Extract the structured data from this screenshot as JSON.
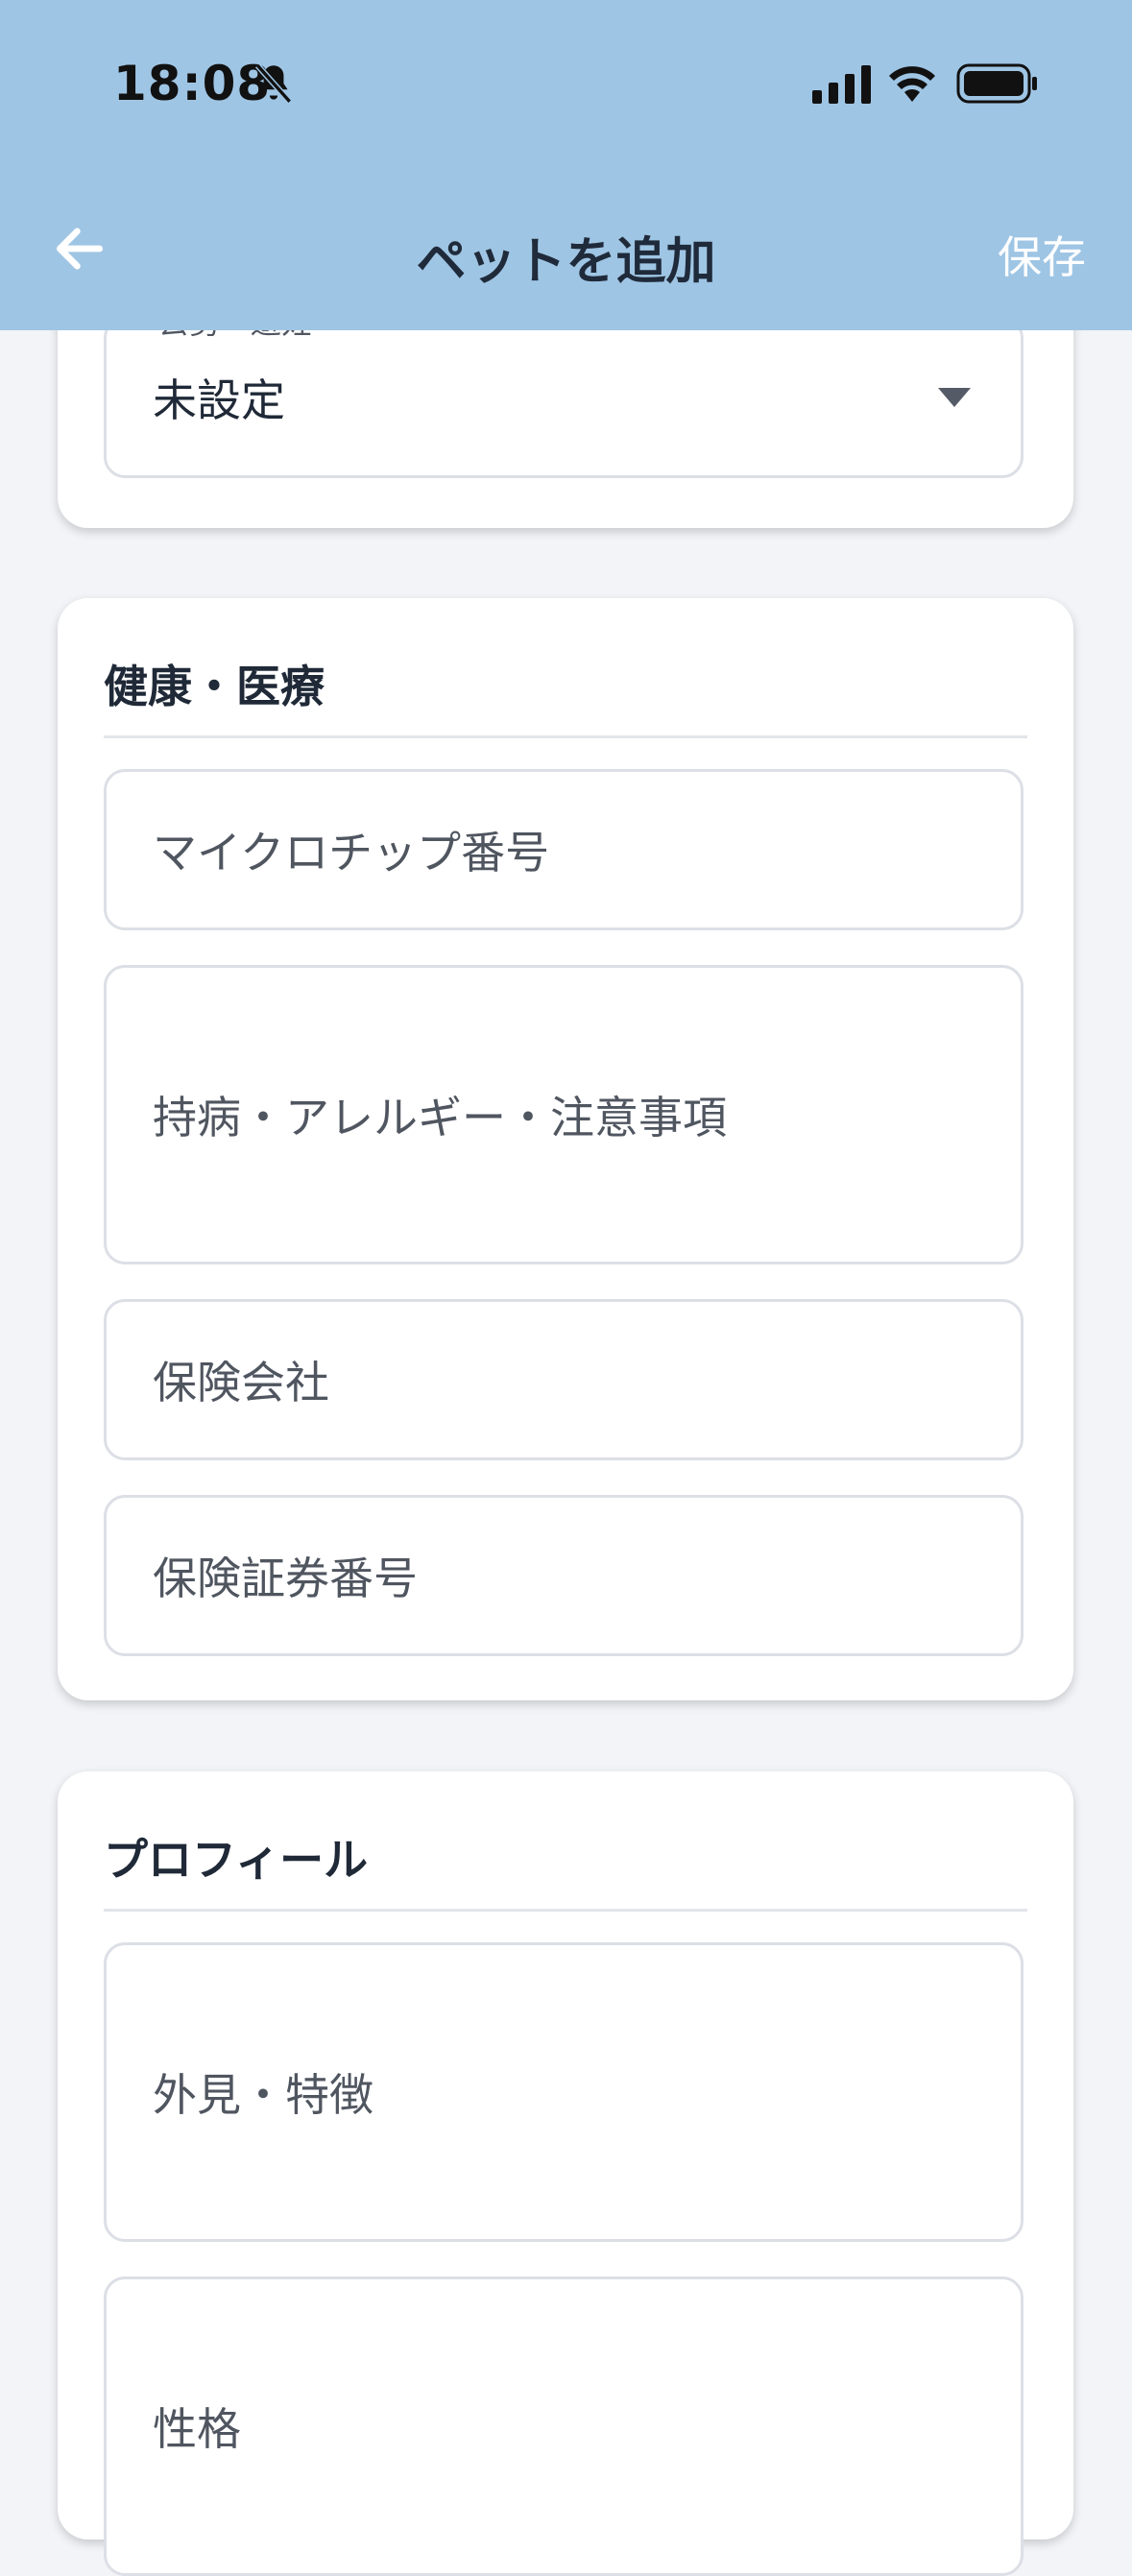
{
  "status_bar": {
    "time": "18:08"
  },
  "appbar": {
    "title": "ペットを追加",
    "save_label": "保存"
  },
  "top_card": {
    "select_label": "去勢・避妊",
    "select_value": "未設定"
  },
  "health_section": {
    "title": "健康・医療",
    "fields": {
      "microchip": "マイクロチップ番号",
      "conditions": "持病・アレルギー・注意事項",
      "insurance_company": "保険会社",
      "insurance_number": "保険証券番号"
    }
  },
  "profile_section": {
    "title": "プロフィール",
    "fields": {
      "appearance": "外見・特徴",
      "personality": "性格"
    }
  },
  "colors": {
    "appbar_bg": "#9fc5e4",
    "page_bg": "#f2f4f8",
    "card_bg": "#ffffff"
  }
}
